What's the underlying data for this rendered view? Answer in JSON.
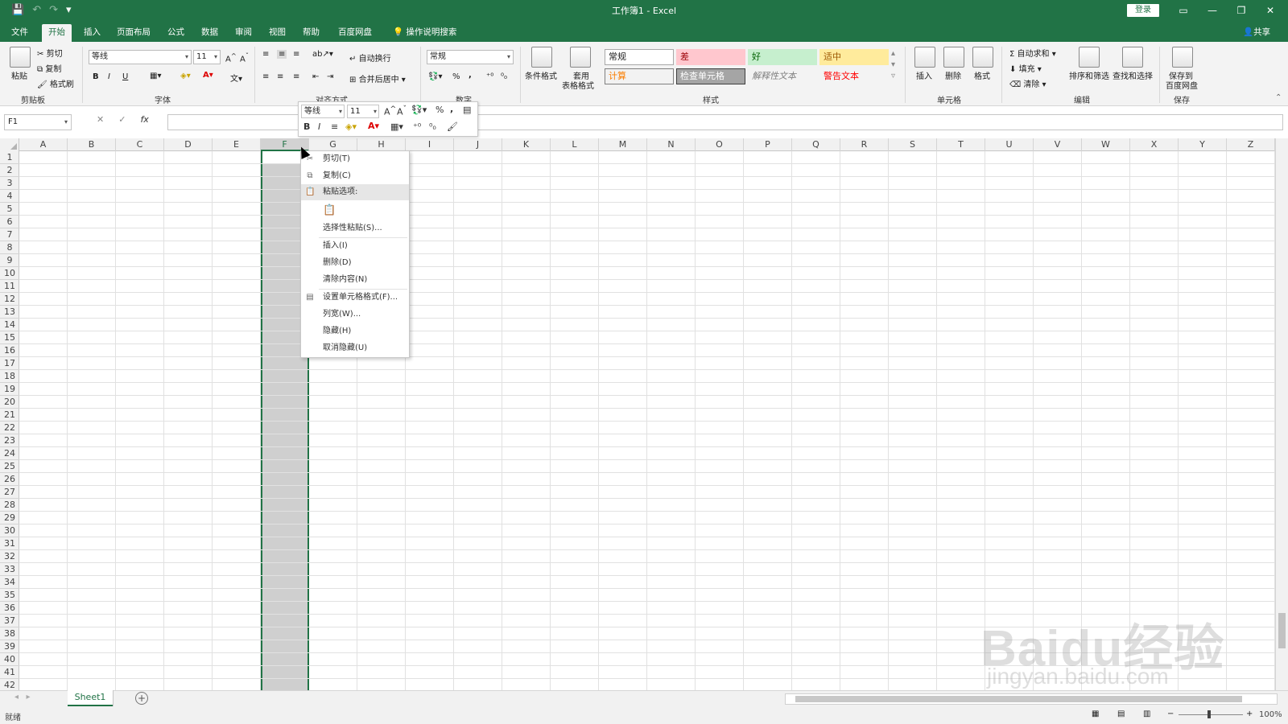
{
  "window": {
    "title": "工作簿1  -  Excel",
    "login_label": "登录",
    "share_label": "共享",
    "qat": {
      "save": "💾",
      "undo": "↶",
      "redo": "↷",
      "customize": "▾"
    },
    "controls": {
      "ribbon_options": "▭",
      "minimize": "—",
      "restore": "❐",
      "close": "✕"
    }
  },
  "tabs": [
    {
      "label": "文件"
    },
    {
      "label": "开始"
    },
    {
      "label": "插入"
    },
    {
      "label": "页面布局"
    },
    {
      "label": "公式"
    },
    {
      "label": "数据"
    },
    {
      "label": "审阅"
    },
    {
      "label": "视图"
    },
    {
      "label": "帮助"
    },
    {
      "label": "百度网盘"
    }
  ],
  "tell_me": "操作说明搜索",
  "ribbon": {
    "clipboard": {
      "label": "剪贴板",
      "paste": "粘贴",
      "cut": "剪切",
      "copy": "复制",
      "format_painter": "格式刷"
    },
    "font": {
      "label": "字体",
      "name": "等线",
      "size": "11",
      "bold": "B",
      "italic": "I",
      "underline": "U"
    },
    "alignment": {
      "label": "对齐方式",
      "wrap": "自动换行",
      "merge": "合并后居中"
    },
    "number": {
      "label": "数字",
      "format": "常规",
      "percent": "%",
      "comma": ","
    },
    "styles": {
      "label": "样式",
      "conditional": "条件格式",
      "table_line1": "套用",
      "table_line2": "表格格式",
      "cells": [
        {
          "text": "常规",
          "bg": "#ffffff",
          "fg": "#222222",
          "border": "#a8a8a8"
        },
        {
          "text": "差",
          "bg": "#ffc7ce",
          "fg": "#9c0006",
          "border": "transparent"
        },
        {
          "text": "好",
          "bg": "#c6efce",
          "fg": "#006100",
          "border": "transparent"
        },
        {
          "text": "适中",
          "bg": "#ffeb9c",
          "fg": "#9c5700",
          "border": "transparent"
        },
        {
          "text": "计算",
          "bg": "#f2f2f2",
          "fg": "#fa7d00",
          "border": "#7f7f7f"
        },
        {
          "text": "检查单元格",
          "bg": "#a5a5a5",
          "fg": "#ffffff",
          "border": "#3f3f3f"
        },
        {
          "text": "解释性文本",
          "bg": "transparent",
          "fg": "#7f7f7f",
          "border": "transparent"
        },
        {
          "text": "警告文本",
          "bg": "transparent",
          "fg": "#ff0000",
          "border": "transparent"
        }
      ]
    },
    "cells": {
      "label": "单元格",
      "insert": "插入",
      "delete": "删除",
      "format": "格式"
    },
    "editing": {
      "label": "编辑",
      "autosum": "自动求和",
      "fill": "填充",
      "clear": "清除",
      "sort": "排序和筛选",
      "find": "查找和选择"
    },
    "save": {
      "label": "保存",
      "line1": "保存到",
      "line2": "百度网盘"
    }
  },
  "formula_bar": {
    "name_box": "F1",
    "cancel": "✕",
    "enter": "✓",
    "fx": "fx",
    "value": ""
  },
  "grid": {
    "columns": [
      "A",
      "B",
      "C",
      "D",
      "E",
      "F",
      "G",
      "H",
      "I",
      "J",
      "K",
      "L",
      "M",
      "N",
      "O",
      "P",
      "Q",
      "R",
      "S",
      "T",
      "U",
      "V",
      "W",
      "X",
      "Y",
      "Z"
    ],
    "rows": [
      "1",
      "2",
      "3",
      "4",
      "5",
      "6",
      "7",
      "8",
      "9",
      "10",
      "11",
      "12",
      "13",
      "14",
      "15",
      "16",
      "17",
      "18",
      "19",
      "20",
      "21",
      "22",
      "23",
      "24",
      "25",
      "26",
      "27",
      "28",
      "29",
      "30",
      "31",
      "32",
      "33",
      "34",
      "35",
      "36",
      "37",
      "38",
      "39",
      "40",
      "41",
      "42"
    ],
    "selected_column": "F"
  },
  "mini_toolbar": {
    "font": "等线",
    "size": "11",
    "percent": "%",
    "comma": ","
  },
  "context_menu": {
    "items": [
      {
        "label": "剪切(T)",
        "icon": "scissors-icon",
        "glyph": "✂"
      },
      {
        "label": "复制(C)",
        "icon": "copy-icon",
        "glyph": "⧉"
      },
      {
        "label": "粘贴选项:",
        "icon": "paste-icon",
        "glyph": "📋"
      },
      {
        "label": "选择性粘贴(S)...",
        "icon": "",
        "glyph": ""
      },
      {
        "label": "插入(I)",
        "icon": "",
        "glyph": ""
      },
      {
        "label": "删除(D)",
        "icon": "",
        "glyph": ""
      },
      {
        "label": "清除内容(N)",
        "icon": "",
        "glyph": ""
      },
      {
        "label": "设置单元格格式(F)...",
        "icon": "format-cells-icon",
        "glyph": "▤"
      },
      {
        "label": "列宽(W)...",
        "icon": "",
        "glyph": ""
      },
      {
        "label": "隐藏(H)",
        "icon": "",
        "glyph": ""
      },
      {
        "label": "取消隐藏(U)",
        "icon": "",
        "glyph": ""
      }
    ]
  },
  "sheets": [
    {
      "label": "Sheet1"
    }
  ],
  "add_sheet": "+",
  "status": {
    "ready": "就绪",
    "zoom": "100%"
  },
  "watermark": {
    "text": "Baidu经验",
    "sub": "jingyan.baidu.com"
  },
  "colors": {
    "accent": "#217346"
  }
}
